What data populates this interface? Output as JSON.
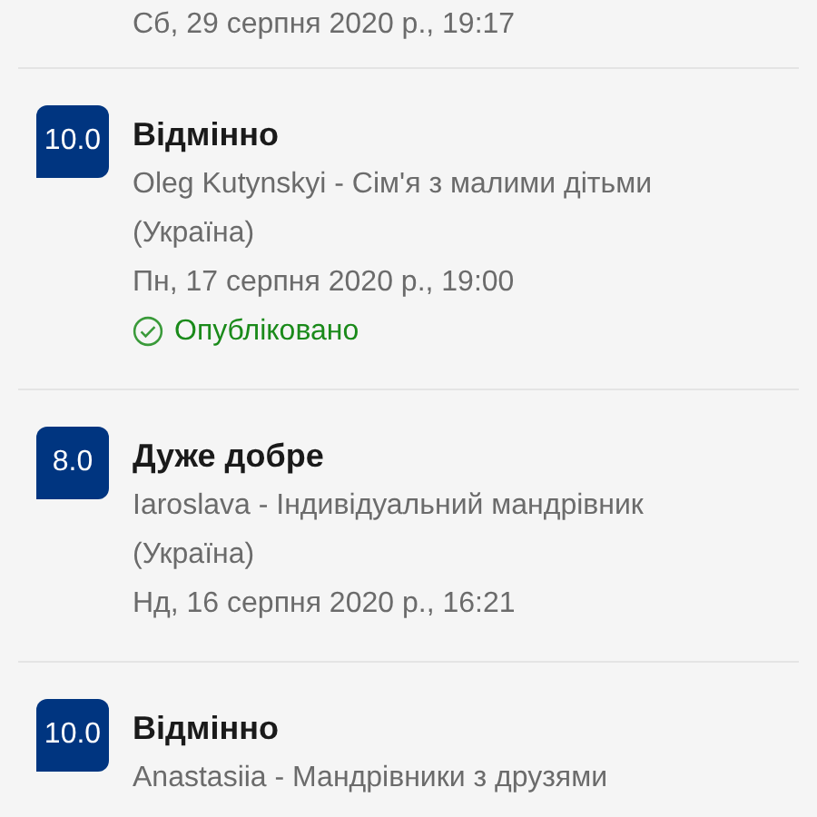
{
  "top_date": "Сб, 29 серпня 2020 р., 19:17",
  "reviews": [
    {
      "score": "10.0",
      "title": "Відмінно",
      "author": "Oleg Kutynskyi - Сім'я з малими дітьми (Україна)",
      "date": "Пн, 17 серпня 2020 р., 19:00",
      "status": "Опубліковано"
    },
    {
      "score": "8.0",
      "title": "Дуже добре",
      "author": "Iaroslava - Індивідуальний мандрівник (Україна)",
      "date": "Нд, 16 серпня 2020 р., 16:21"
    },
    {
      "score": "10.0",
      "title": "Відмінно",
      "author": "Anastasiia - Мандрівники з друзями"
    }
  ]
}
